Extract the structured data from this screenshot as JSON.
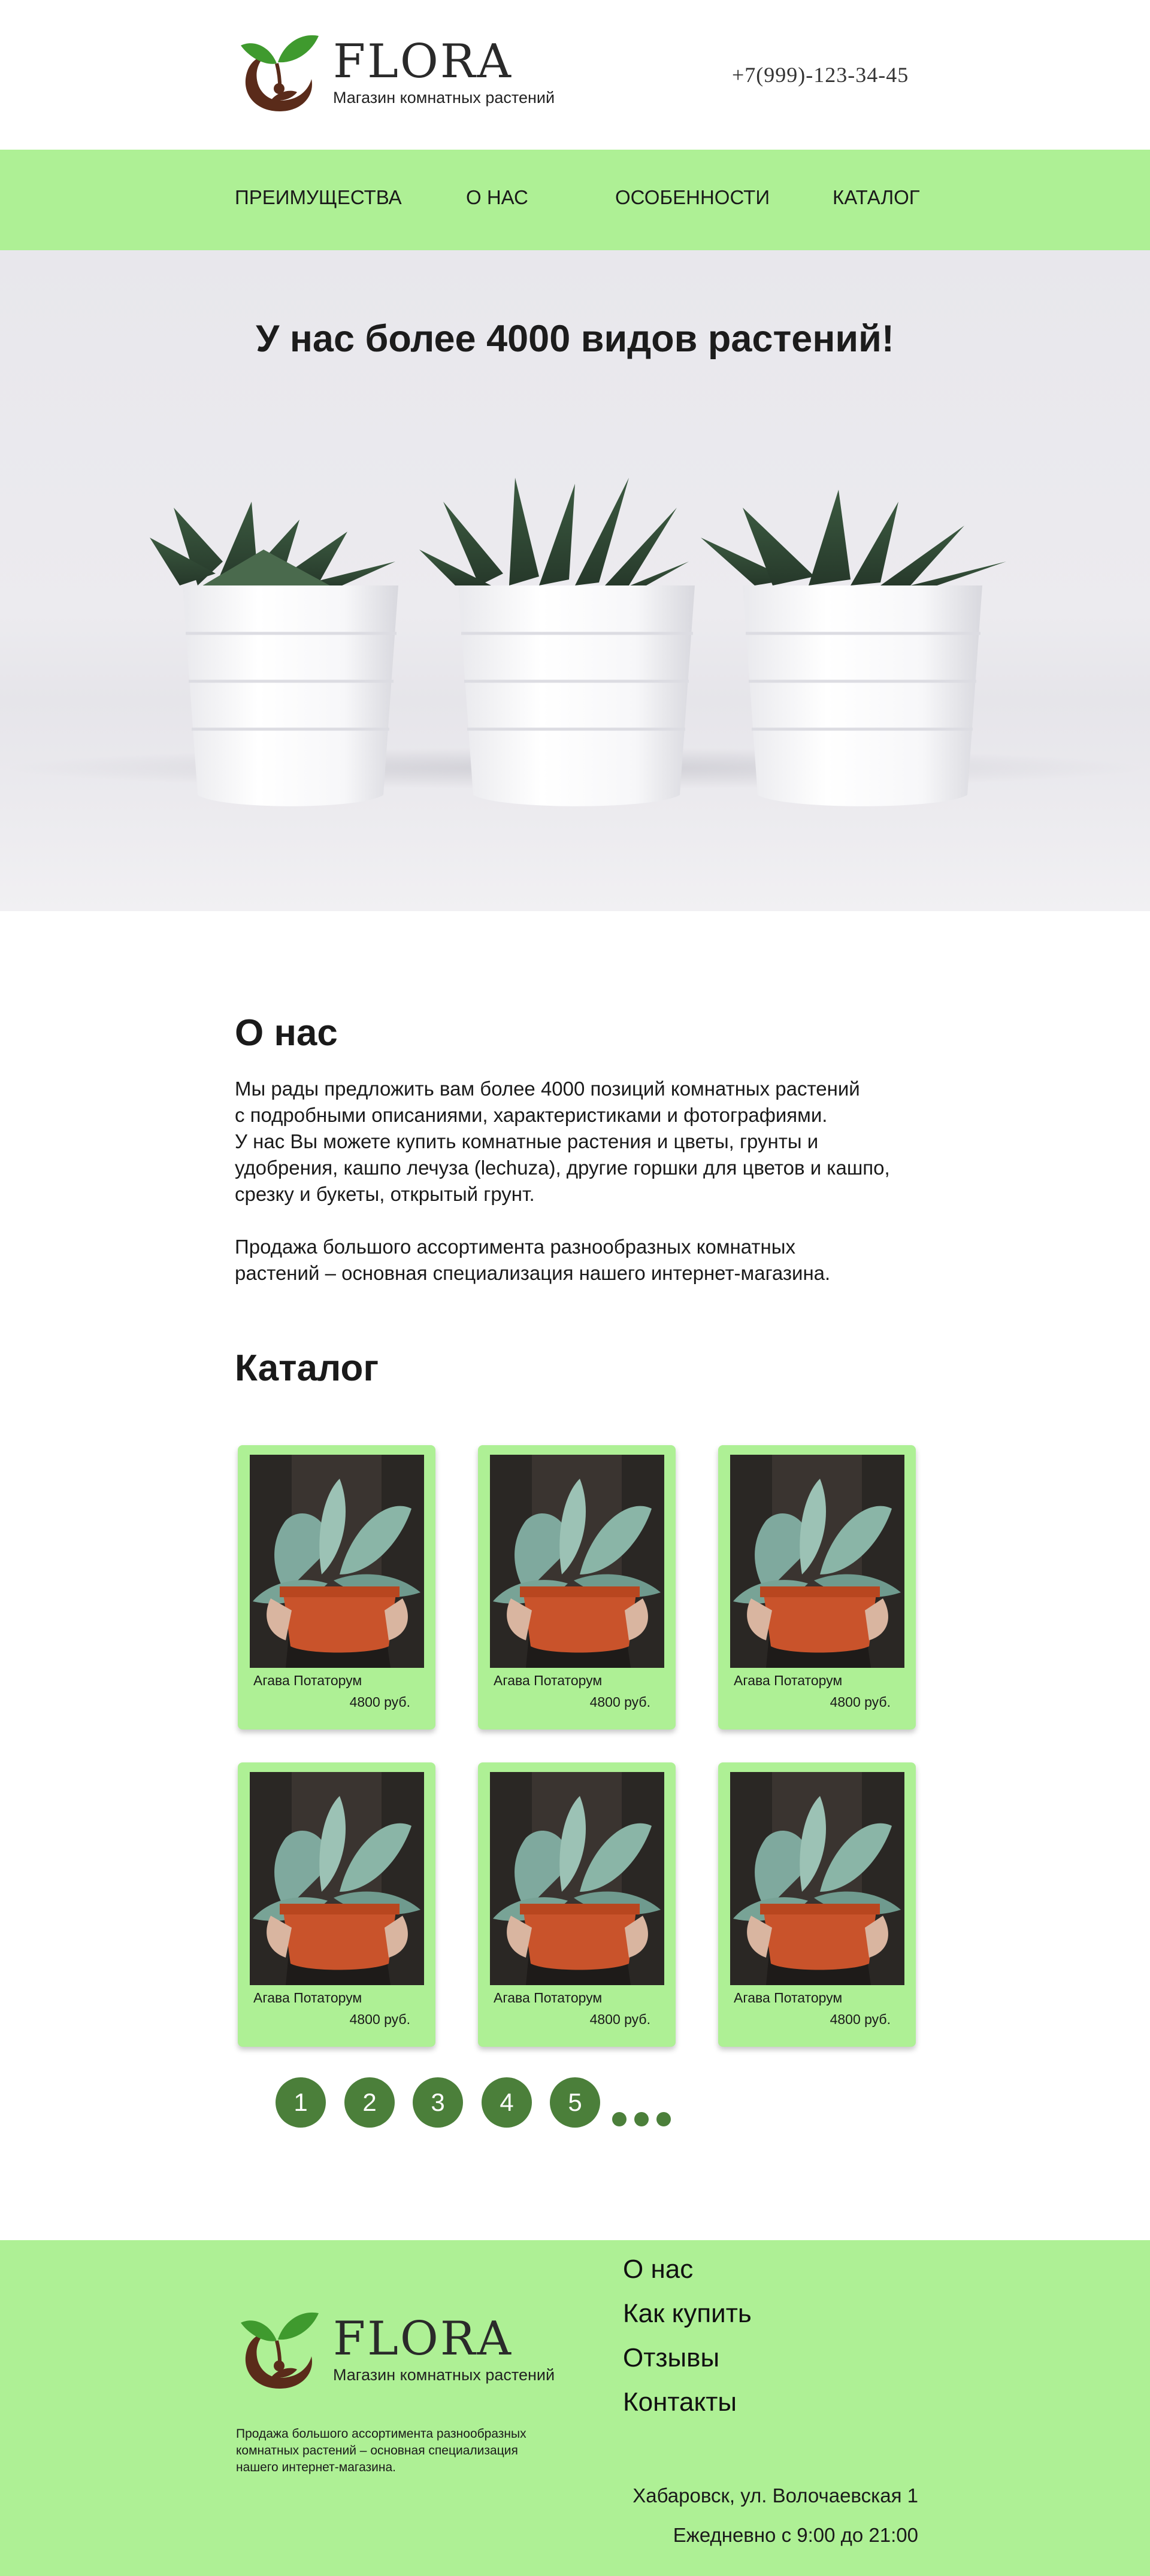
{
  "header": {
    "logo_name": "FLORA",
    "logo_subtitle": "Магазин комнатных растений",
    "phone": "+7(999)-123-34-45"
  },
  "nav": {
    "items": [
      {
        "label": "ПРЕИМУЩЕСТВА"
      },
      {
        "label": "О НАС"
      },
      {
        "label": "ОСОБЕННОСТИ"
      },
      {
        "label": "КАТАЛОГ"
      }
    ]
  },
  "hero": {
    "title": "У нас более 4000 видов растений!"
  },
  "about": {
    "title": "О нас",
    "paragraph1": "Мы рады предложить вам более 4000 позиций комнатных растений\nс подробными описаниями, характеристиками и фотографиями.\nУ нас Вы можете купить комнатные растения и цветы, грунты и\nудобрения,  кашпо лечуза (lechuza), другие горшки для цветов и кашпо,\nсрезку и букеты,  открытый грунт.",
    "paragraph2": "Продажа большого ассортимента разнообразных комнатных\nрастений – основная специализация нашего интернет-магазина."
  },
  "catalog": {
    "title": "Каталог",
    "items": [
      {
        "name": "Агава Потаторум",
        "price": "4800 руб."
      },
      {
        "name": "Агава Потаторум",
        "price": "4800 руб."
      },
      {
        "name": "Агава Потаторум",
        "price": "4800 руб."
      },
      {
        "name": "Агава Потаторум",
        "price": "4800 руб."
      },
      {
        "name": "Агава Потаторум",
        "price": "4800 руб."
      },
      {
        "name": "Агава Потаторум",
        "price": "4800 руб."
      }
    ]
  },
  "pagination": {
    "pages": [
      "1",
      "2",
      "3",
      "4",
      "5"
    ]
  },
  "footer": {
    "logo_name": "FLORA",
    "logo_subtitle": "Магазин комнатных растений",
    "description": "Продажа большого ассортимента разнообразных\nкомнатных растений – основная специализация\nнашего интернет-магазина.",
    "links": [
      {
        "label": "О нас"
      },
      {
        "label": "Как купить"
      },
      {
        "label": "Отзывы"
      },
      {
        "label": "Контакты"
      }
    ],
    "address": "Хабаровск, ул. Волочаевская 1",
    "hours": "Ежедневно с 9:00 до 21:00"
  },
  "colors": {
    "accent_green": "#aef095",
    "button_green": "#4b7f3a",
    "logo_brown": "#5a2b1a",
    "logo_leaf": "#3f9a2e"
  }
}
